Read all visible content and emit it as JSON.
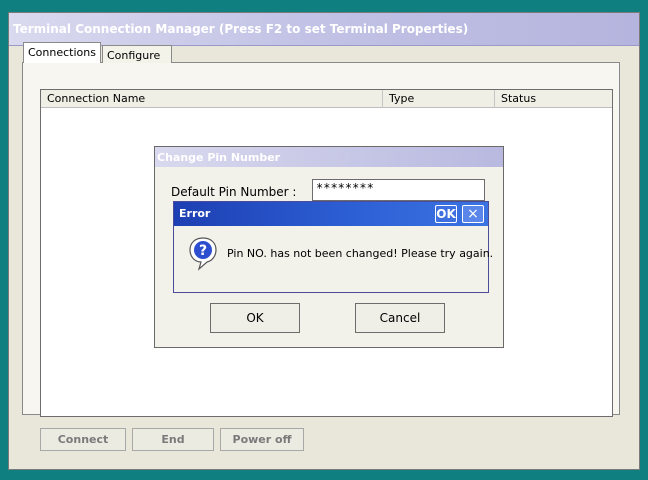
{
  "window": {
    "title": "Terminal Connection Manager (Press F2 to set Terminal Properties)"
  },
  "tabs": [
    {
      "label": "Connections",
      "selected": true
    },
    {
      "label": "Configure",
      "selected": false
    }
  ],
  "list": {
    "columns": [
      "Connection Name",
      "Type",
      "Status"
    ],
    "rows": []
  },
  "bottom_buttons": {
    "connect": "Connect",
    "end": "End",
    "power_off": "Power off"
  },
  "pin_dialog": {
    "title": "Change Pin Number",
    "label": "Default Pin Number :",
    "value": "********",
    "ok": "OK",
    "cancel": "Cancel"
  },
  "error_dialog": {
    "title": "Error",
    "ok": "OK",
    "close": "×",
    "icon": "question-icon",
    "message": "Pin NO. has not been changed! Please try again."
  },
  "colors": {
    "desktop": "#0f7f7f",
    "error_titlebar": "#2e61d6"
  }
}
